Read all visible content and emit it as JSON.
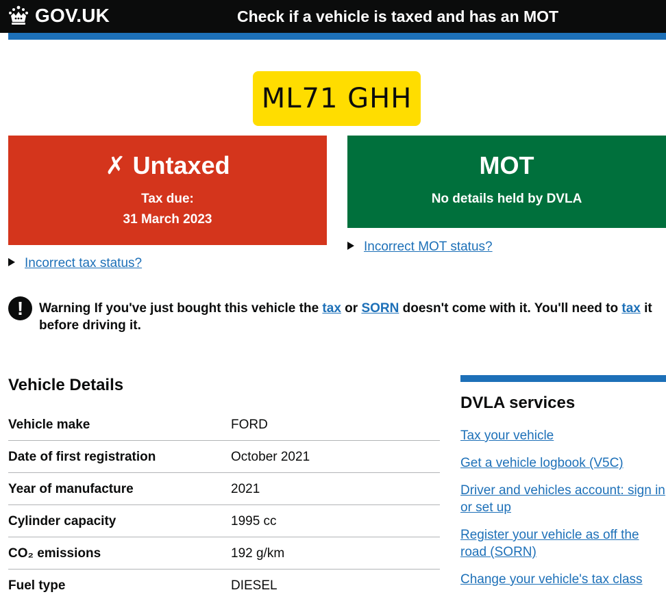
{
  "header": {
    "logo_text": "GOV.UK",
    "service_name": "Check if a vehicle is taxed and has an MOT"
  },
  "vehicle": {
    "registration": "ML71 GHH"
  },
  "tax_status": {
    "icon": "✗",
    "title": "Untaxed",
    "label": "Tax due:",
    "date": "31 March 2023",
    "color": "#d4351c",
    "toggle_label": "Incorrect tax status?"
  },
  "mot_status": {
    "title": "MOT",
    "detail": "No details held by DVLA",
    "color": "#00703c",
    "toggle_label": "Incorrect MOT status?"
  },
  "warning": {
    "icon": "!",
    "prefix": "Warning",
    "text1": " If you've just bought this vehicle the ",
    "link_tax": "tax",
    "text2": " or ",
    "link_sorn": "SORN",
    "text3": " doesn't come with it. You'll need to ",
    "link_tax2": "tax",
    "text4": " it before driving it."
  },
  "vehicle_details": {
    "heading": "Vehicle Details",
    "rows": [
      {
        "key": "Vehicle make",
        "value": "FORD"
      },
      {
        "key": "Date of first registration",
        "value": "October 2021"
      },
      {
        "key": "Year of manufacture",
        "value": "2021"
      },
      {
        "key": "Cylinder capacity",
        "value": "1995 cc"
      },
      {
        "key": "CO₂ emissions",
        "value": "192 g/km"
      },
      {
        "key": "Fuel type",
        "value": "DIESEL"
      }
    ]
  },
  "services": {
    "heading": "DVLA services",
    "links": [
      "Tax your vehicle",
      "Get a vehicle logbook (V5C)",
      "Driver and vehicles account: sign in or set up",
      "Register your vehicle as off the road (SORN)",
      "Change your vehicle's tax class"
    ]
  },
  "colors": {
    "header_bg": "#0b0c0c",
    "accent_blue": "#1d70b8",
    "plate_yellow": "#ffdd00"
  }
}
